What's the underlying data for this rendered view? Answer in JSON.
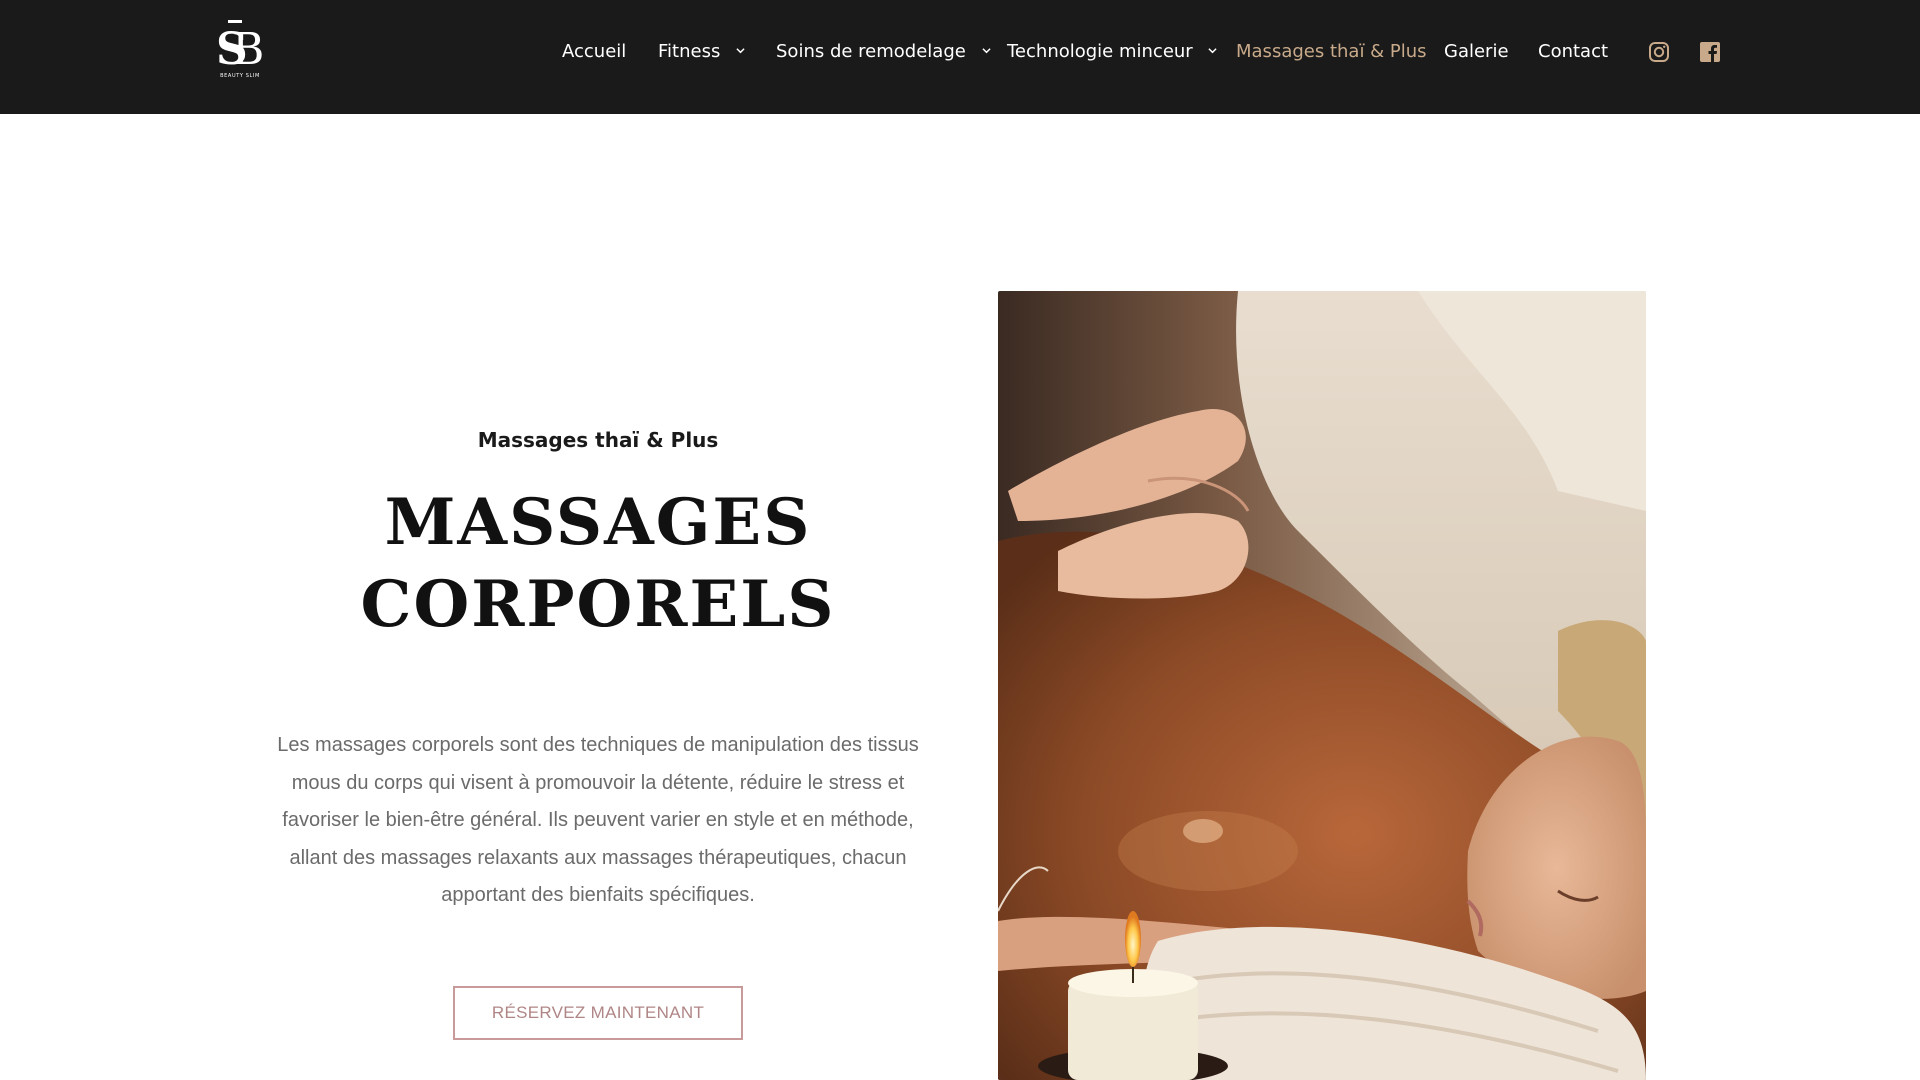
{
  "header": {
    "logo_text": "BEAUTY SLIM",
    "logo_monogram": "SB"
  },
  "nav": {
    "items": [
      {
        "label": "Accueil",
        "has_dropdown": false,
        "active": false
      },
      {
        "label": "Fitness",
        "has_dropdown": true,
        "active": false
      },
      {
        "label": "Soins de remodelage",
        "has_dropdown": true,
        "active": false
      },
      {
        "label": "Technologie minceur",
        "has_dropdown": true,
        "active": false
      },
      {
        "label": "Massages thaï & Plus",
        "has_dropdown": false,
        "active": true
      },
      {
        "label": "Galerie",
        "has_dropdown": false,
        "active": false
      },
      {
        "label": "Contact",
        "has_dropdown": false,
        "active": false
      }
    ],
    "social": [
      "instagram-icon",
      "facebook-icon"
    ]
  },
  "hero": {
    "subtitle": "Massages thaï & Plus",
    "title_line1": "MASSAGES",
    "title_line2": "CORPORELS",
    "description": "Les massages corporels sont des techniques de manipulation des tissus mous du corps qui visent à promouvoir la détente, réduire le stress et favoriser le bien-être général. Ils peuvent varier en style et en méthode, allant des massages relaxants aux massages thérapeutiques, chacun apportant des bienfaits spécifiques.",
    "cta_label": "RÉSERVEZ MAINTENANT"
  },
  "colors": {
    "header_bg": "#1a1a1a",
    "active_nav": "#c8aa8a",
    "cta_border": "#c99a9a",
    "body_text": "#6b6b6b"
  }
}
